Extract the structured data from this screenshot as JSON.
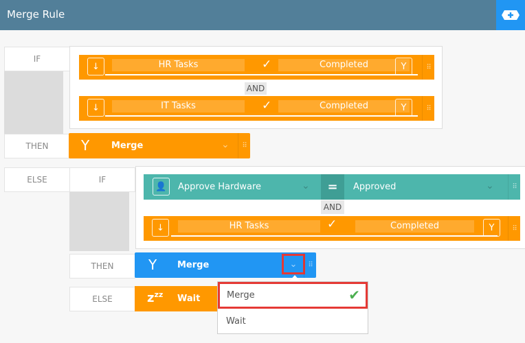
{
  "header": {
    "title": "Merge Rule",
    "add_button": "add-icon"
  },
  "rule": {
    "if_label": "IF",
    "then_label": "THEN",
    "else_label": "ELSE",
    "and_label": "AND",
    "conditions": [
      {
        "left": "HR Tasks",
        "operator": "check",
        "right": "Completed"
      },
      {
        "left": "IT Tasks",
        "operator": "check",
        "right": "Completed"
      }
    ],
    "then_action": "Merge",
    "else": {
      "if_label": "IF",
      "then_label": "THEN",
      "else_label": "ELSE",
      "and_label": "AND",
      "conditions": [
        {
          "left": "Approve Hardware",
          "operator": "=",
          "right": "Approved"
        },
        {
          "left": "HR Tasks",
          "operator": "check",
          "right": "Completed"
        }
      ],
      "then_action": "Merge",
      "else_action": "Wait"
    }
  },
  "dropdown": {
    "options": [
      {
        "label": "Merge",
        "selected": true
      },
      {
        "label": "Wait",
        "selected": false
      }
    ]
  },
  "colors": {
    "orange": "#ff9800",
    "teal": "#4db6ac",
    "blue": "#2196f3",
    "header": "#527f99",
    "highlight": "#e53935"
  }
}
